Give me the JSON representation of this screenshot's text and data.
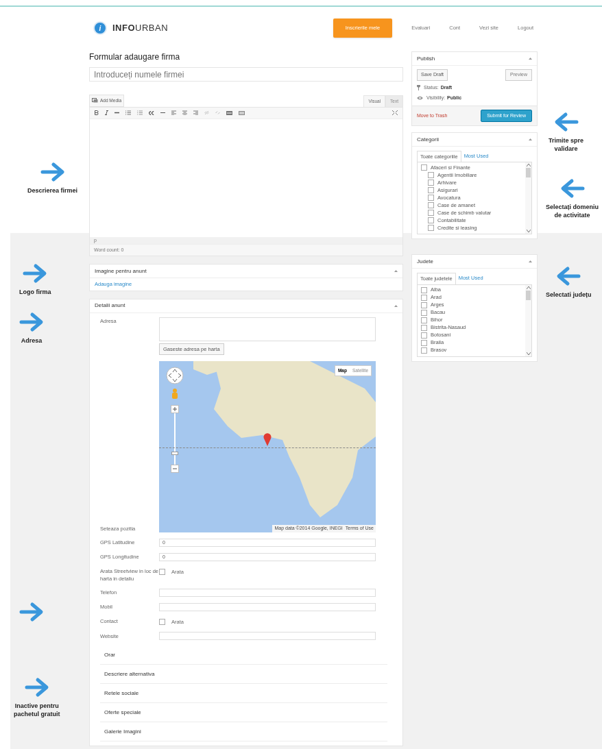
{
  "header": {
    "logo_mark": "i",
    "logo_text": "**INFO**URBAN",
    "nav": [
      {
        "label": "Inscrierile mele",
        "selected": true
      },
      {
        "label": "Evaluari",
        "selected": false
      },
      {
        "label": "Cont",
        "selected": false
      },
      {
        "label": "Vezi site",
        "selected": false
      },
      {
        "label": "Logout",
        "selected": false
      }
    ]
  },
  "page_title": "Formular adaugare firma",
  "title_field": {
    "placeholder": "Introduceți numele firmei"
  },
  "editor": {
    "add_media": "Add Media",
    "tabs": [
      {
        "label": "Visual",
        "selected": true
      },
      {
        "label": "Text",
        "selected": false
      }
    ],
    "path": "p",
    "word_count": "Word count: 0"
  },
  "image_box": {
    "title": "Imagine pentru anunt",
    "link": "Adauga imagine"
  },
  "details": {
    "title": "Detalii anunt",
    "fields": [
      {
        "kind": "textarea",
        "label": "Adresa",
        "button": "Gaseste adresa pe harta"
      },
      {
        "kind": "map",
        "label": "Seteaza pozitia",
        "map_types": [
          {
            "label": "Map",
            "selected": true
          },
          {
            "label": "Satellite",
            "selected": false
          }
        ],
        "zoom": {
          "level": 0.2
        },
        "attribution": "Map data ©2014 Google, INEGI",
        "terms": "Terms of Use"
      },
      {
        "kind": "text",
        "label": "GPS Latitudine",
        "value": "0"
      },
      {
        "kind": "text",
        "label": "GPS Longitudine",
        "value": "0"
      },
      {
        "kind": "checkbox",
        "label": "Arata Streetview in loc de harta in detaliu",
        "option": "Arata",
        "checked": false
      },
      {
        "kind": "text",
        "label": "Telefon"
      },
      {
        "kind": "text",
        "label": "Mobil"
      },
      {
        "kind": "checkbox",
        "label": "Contact",
        "option": "Arata",
        "checked": false
      },
      {
        "kind": "text",
        "label": "Website"
      }
    ],
    "sections": [
      "Orar",
      "Descriere alternativa",
      "Retele sociale",
      "Oferte speciale",
      "Galerie Imagini"
    ]
  },
  "publish": {
    "title": "Publish",
    "save_draft": "Save Draft",
    "preview": "Preview",
    "status_label": "Status:",
    "status_value": "Draft",
    "visibility_label": "Visibility:",
    "visibility_value": "Public",
    "trash": "Move to Trash",
    "submit": "Submit for Review"
  },
  "categories": {
    "title": "Categorii",
    "tabs": [
      {
        "label": "Toate categoriile",
        "selected": true
      },
      {
        "label": "Most Used",
        "selected": false
      }
    ],
    "items": [
      {
        "label": "Afaceri si Finante",
        "checked": false,
        "children": [
          {
            "label": "Agentii Imobiliare",
            "checked": false
          },
          {
            "label": "Arhivare",
            "checked": false
          },
          {
            "label": "Asigurari",
            "checked": false
          },
          {
            "label": "Avocatura",
            "checked": false
          },
          {
            "label": "Case de amanet",
            "checked": false
          },
          {
            "label": "Case de schimb valutar",
            "checked": false
          },
          {
            "label": "Contabilitate",
            "checked": false
          },
          {
            "label": "Credite si leasing",
            "checked": false
          }
        ]
      }
    ]
  },
  "counties": {
    "title": "Judete",
    "tabs": [
      {
        "label": "Toate judetele",
        "selected": true
      },
      {
        "label": "Most Used",
        "selected": false
      }
    ],
    "items": [
      {
        "label": "Alba",
        "checked": false
      },
      {
        "label": "Arad",
        "checked": false
      },
      {
        "label": "Arges",
        "checked": false
      },
      {
        "label": "Bacau",
        "checked": false
      },
      {
        "label": "Bihor",
        "checked": false
      },
      {
        "label": "Bistrita-Nasaud",
        "checked": false
      },
      {
        "label": "Botosani",
        "checked": false
      },
      {
        "label": "Braila",
        "checked": false
      },
      {
        "label": "Brasov",
        "checked": false
      }
    ]
  },
  "annotations": [
    {
      "kind": "right",
      "lines": [
        "Descrierea firmei"
      ]
    },
    {
      "kind": "right",
      "lines": [
        "Logo firma"
      ]
    },
    {
      "kind": "right",
      "lines": [
        "Adresa"
      ]
    },
    {
      "kind": "right"
    },
    {
      "kind": "right",
      "lines": [
        "Inactive pentru",
        "pachetul gratuit"
      ]
    },
    {
      "kind": "left",
      "lines": [
        "Trimite spre",
        "validare"
      ]
    },
    {
      "kind": "left",
      "lines": [
        "Selectați domeniu",
        "de activitate"
      ]
    },
    {
      "kind": "left",
      "lines": [
        "Selectati județu"
      ]
    }
  ]
}
